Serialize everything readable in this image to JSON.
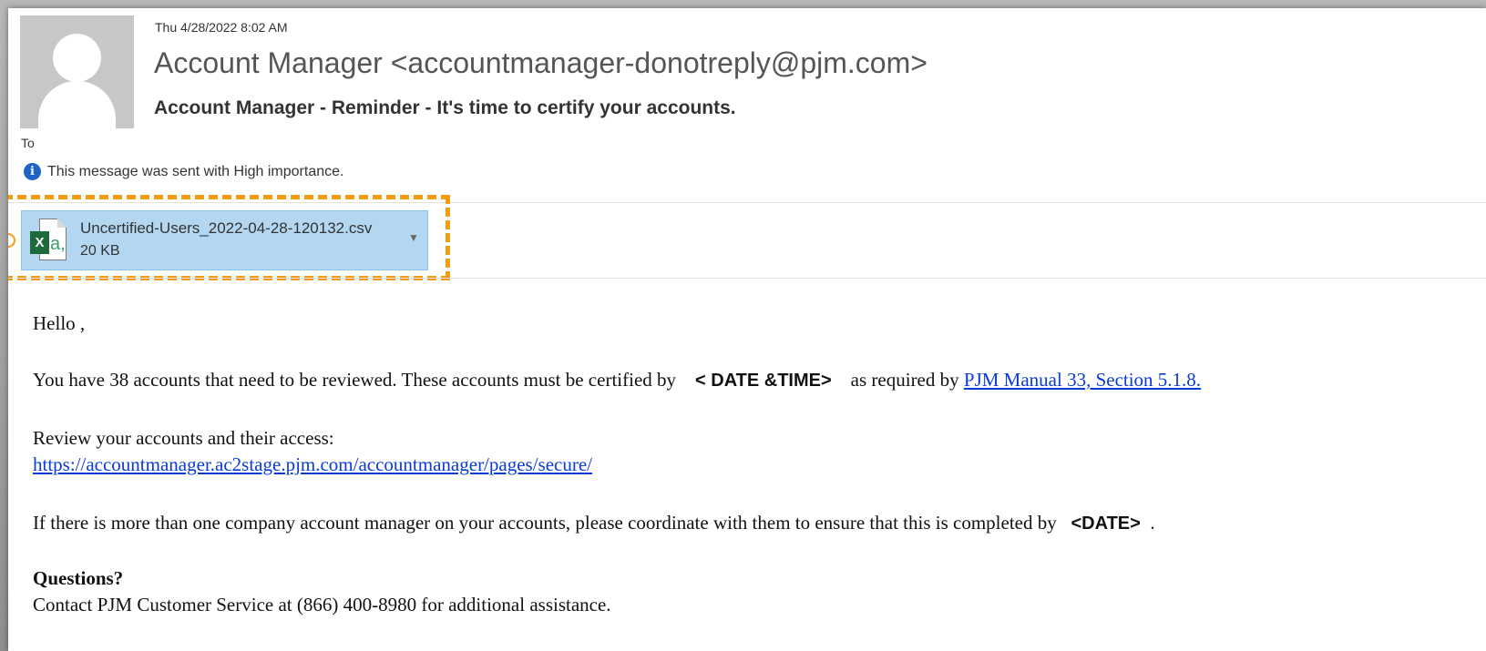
{
  "message": {
    "sent_date": "Thu 4/28/2022 8:02 AM",
    "sender": "Account Manager <accountmanager-donotreply@pjm.com>",
    "subject": "Account Manager - Reminder - It's time to certify your accounts.",
    "to_label": "To",
    "importance_text": "This message was sent with High importance."
  },
  "attachment": {
    "file_name": "Uncertified-Users_2022-04-28-120132.csv",
    "file_size": "20 KB",
    "badge_letter": "X",
    "page_letter": "a,"
  },
  "body": {
    "greeting": "Hello ,",
    "line1_prefix": "You have 38 accounts that need to be reviewed. These accounts must be certified by",
    "line1_placeholder": "< DATE &TIME>",
    "line1_middle": "as required by",
    "line1_link": "PJM Manual 33, Section 5.1.8.",
    "review_text": "Review your accounts and their access:",
    "review_link": "https://accountmanager.ac2stage.pjm.com/accountmanager/pages/secure/",
    "coordinate_prefix": "If there is more than one company account manager on your accounts, please coordinate with them to ensure that this is completed by",
    "coordinate_placeholder": "<DATE>",
    "coordinate_suffix": ".",
    "questions_heading": "Questions?",
    "contact_text": "Contact PJM Customer Service at (866) 400-8980 for additional assistance."
  },
  "colors": {
    "highlight": "#f39c12",
    "attachment_bg": "#b3d7f0",
    "link": "#0b3bd6",
    "info_icon": "#1f63c6"
  },
  "icons": {
    "info": "info-icon",
    "attachment": "excel-file-icon",
    "dropdown": "chevron-down-icon",
    "avatar": "avatar-placeholder"
  }
}
